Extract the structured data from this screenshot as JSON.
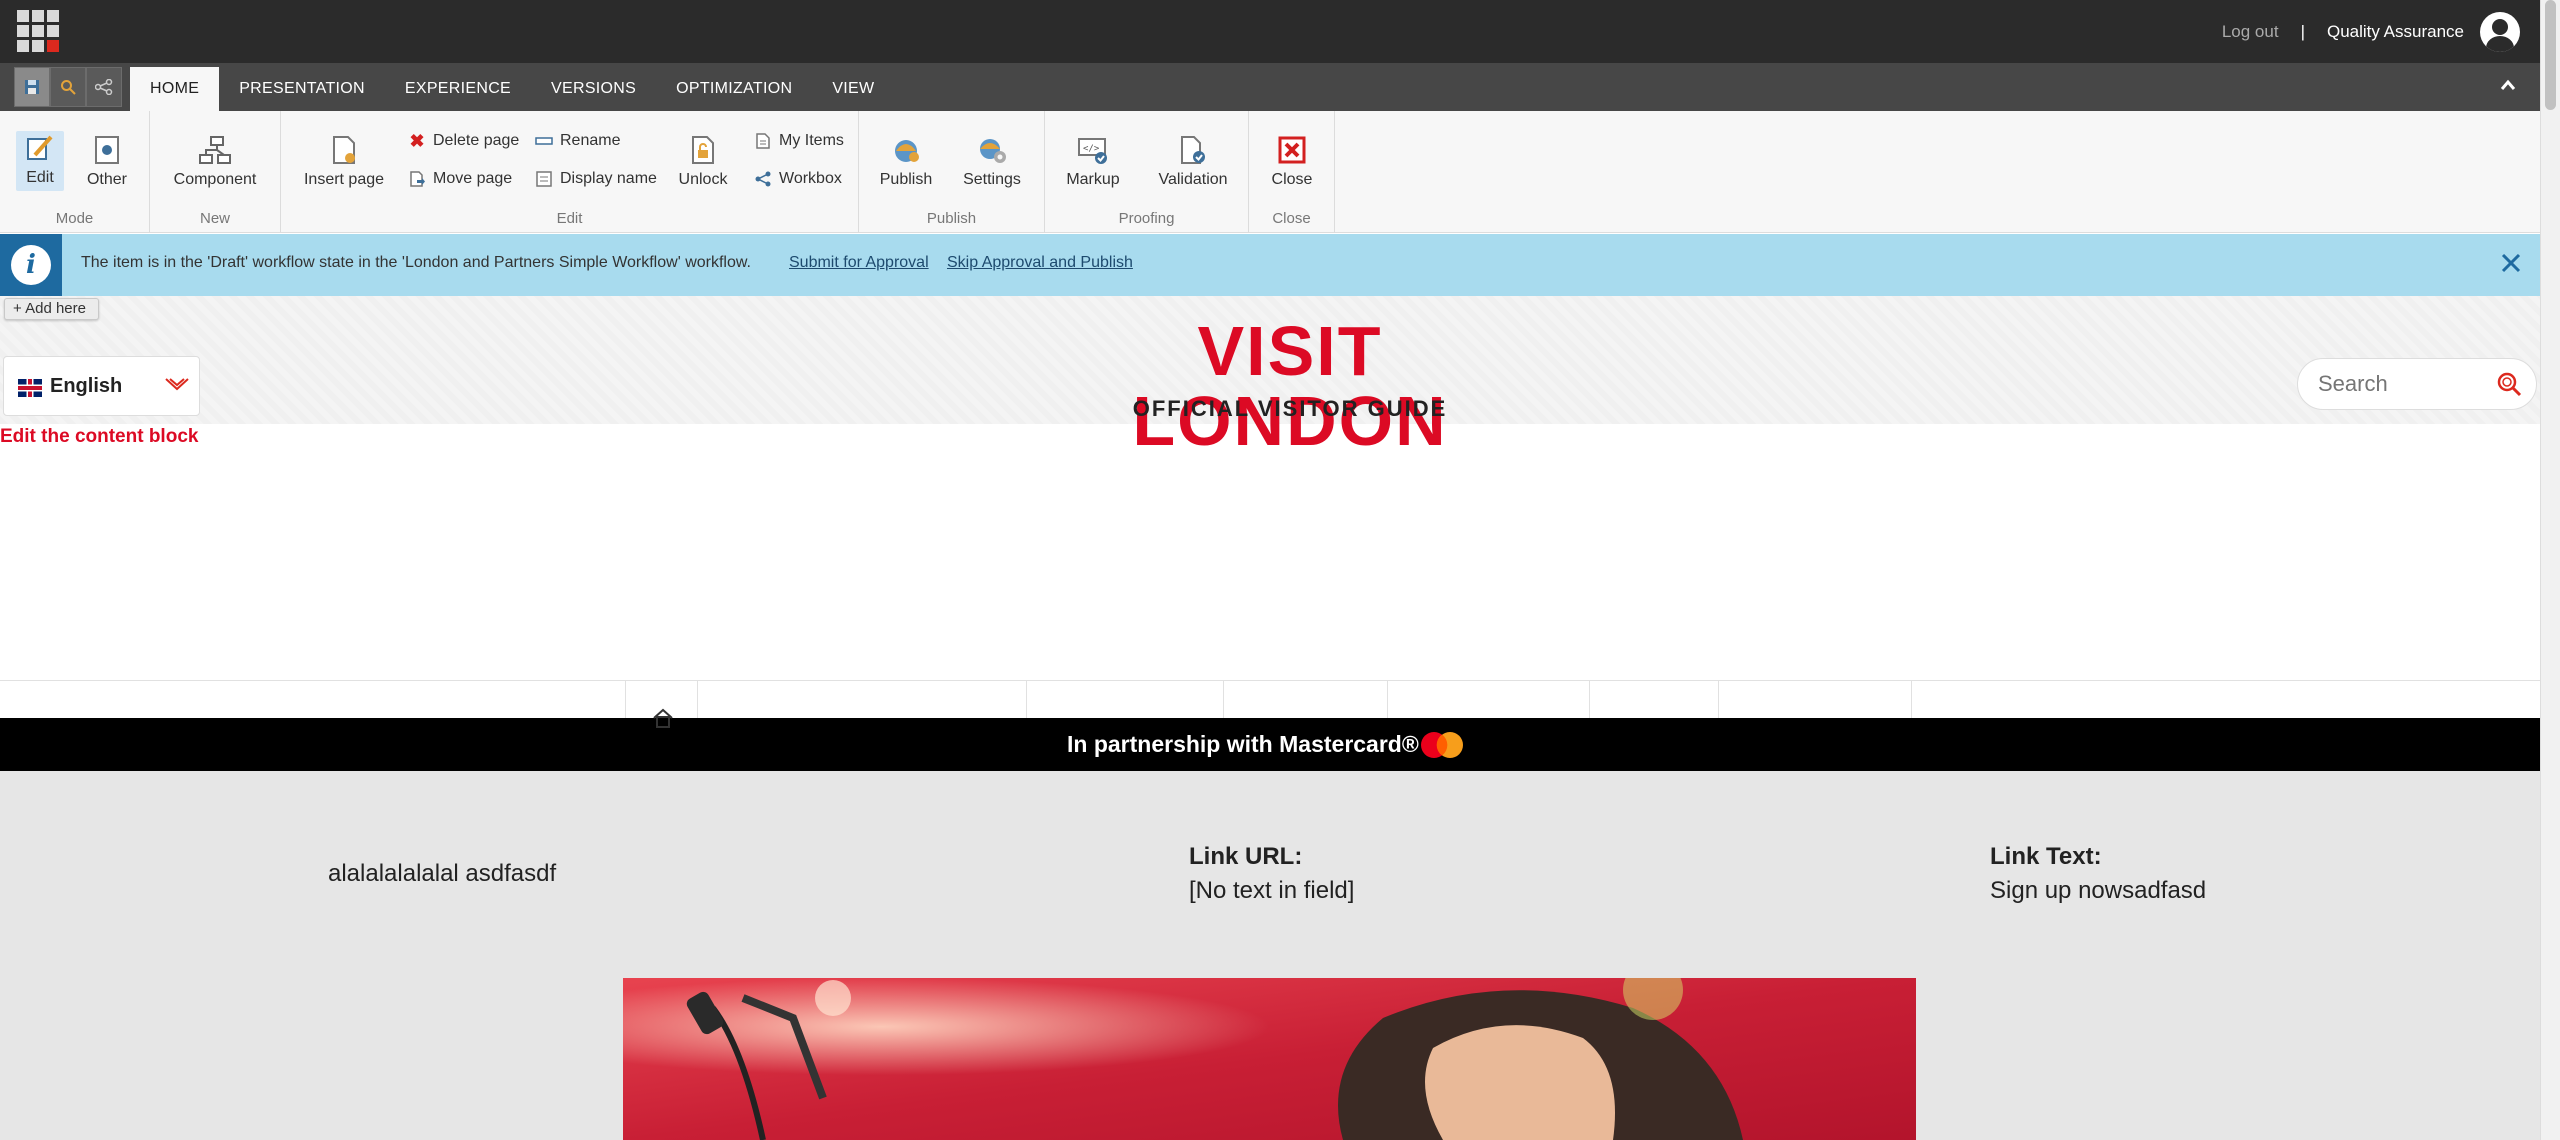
{
  "topbar": {
    "logout_label": "Log out",
    "separator": "|",
    "user_name": "Quality Assurance"
  },
  "tabs": [
    "HOME",
    "PRESENTATION",
    "EXPERIENCE",
    "VERSIONS",
    "OPTIMIZATION",
    "VIEW"
  ],
  "active_tab": "HOME",
  "ribbon": {
    "mode": {
      "label": "Mode",
      "edit": "Edit",
      "other": "Other"
    },
    "new": {
      "label": "New",
      "component": "Component"
    },
    "edit": {
      "label": "Edit",
      "insert_page": "Insert page",
      "delete_page": "Delete page",
      "move_page": "Move page",
      "rename": "Rename",
      "display_name": "Display name",
      "unlock": "Unlock",
      "my_items": "My Items",
      "workbox": "Workbox"
    },
    "publish": {
      "label": "Publish",
      "publish": "Publish",
      "settings": "Settings"
    },
    "proofing": {
      "label": "Proofing",
      "markup": "Markup",
      "validation": "Validation"
    },
    "close": {
      "label": "Close",
      "close": "Close"
    }
  },
  "notification": {
    "message": "The item is in the 'Draft' workflow state in the 'London and Partners Simple Workflow' workflow.",
    "submit_link": "Submit for Approval",
    "skip_link": "Skip Approval and Publish"
  },
  "site": {
    "add_here": "Add here",
    "language": "English",
    "logo_title": "VISIT LONDON",
    "logo_subtitle": "OFFICIAL VISITOR GUIDE",
    "search_placeholder": "Search",
    "edit_block": "Edit the content block",
    "partnership_text": "In partnership with Mastercard®"
  },
  "content": {
    "body_text": "alalalalalalal asdfasdf",
    "link_url_label": "Link URL:",
    "link_url_value": "[No text in field]",
    "link_text_label": "Link Text:",
    "link_text_value": "Sign up nowsadfasd"
  },
  "colors": {
    "brand_red": "#dc0a24",
    "topbar": "#2b2b2b",
    "notification_bg": "#a8dbee",
    "notification_icon": "#1e6aa0"
  }
}
